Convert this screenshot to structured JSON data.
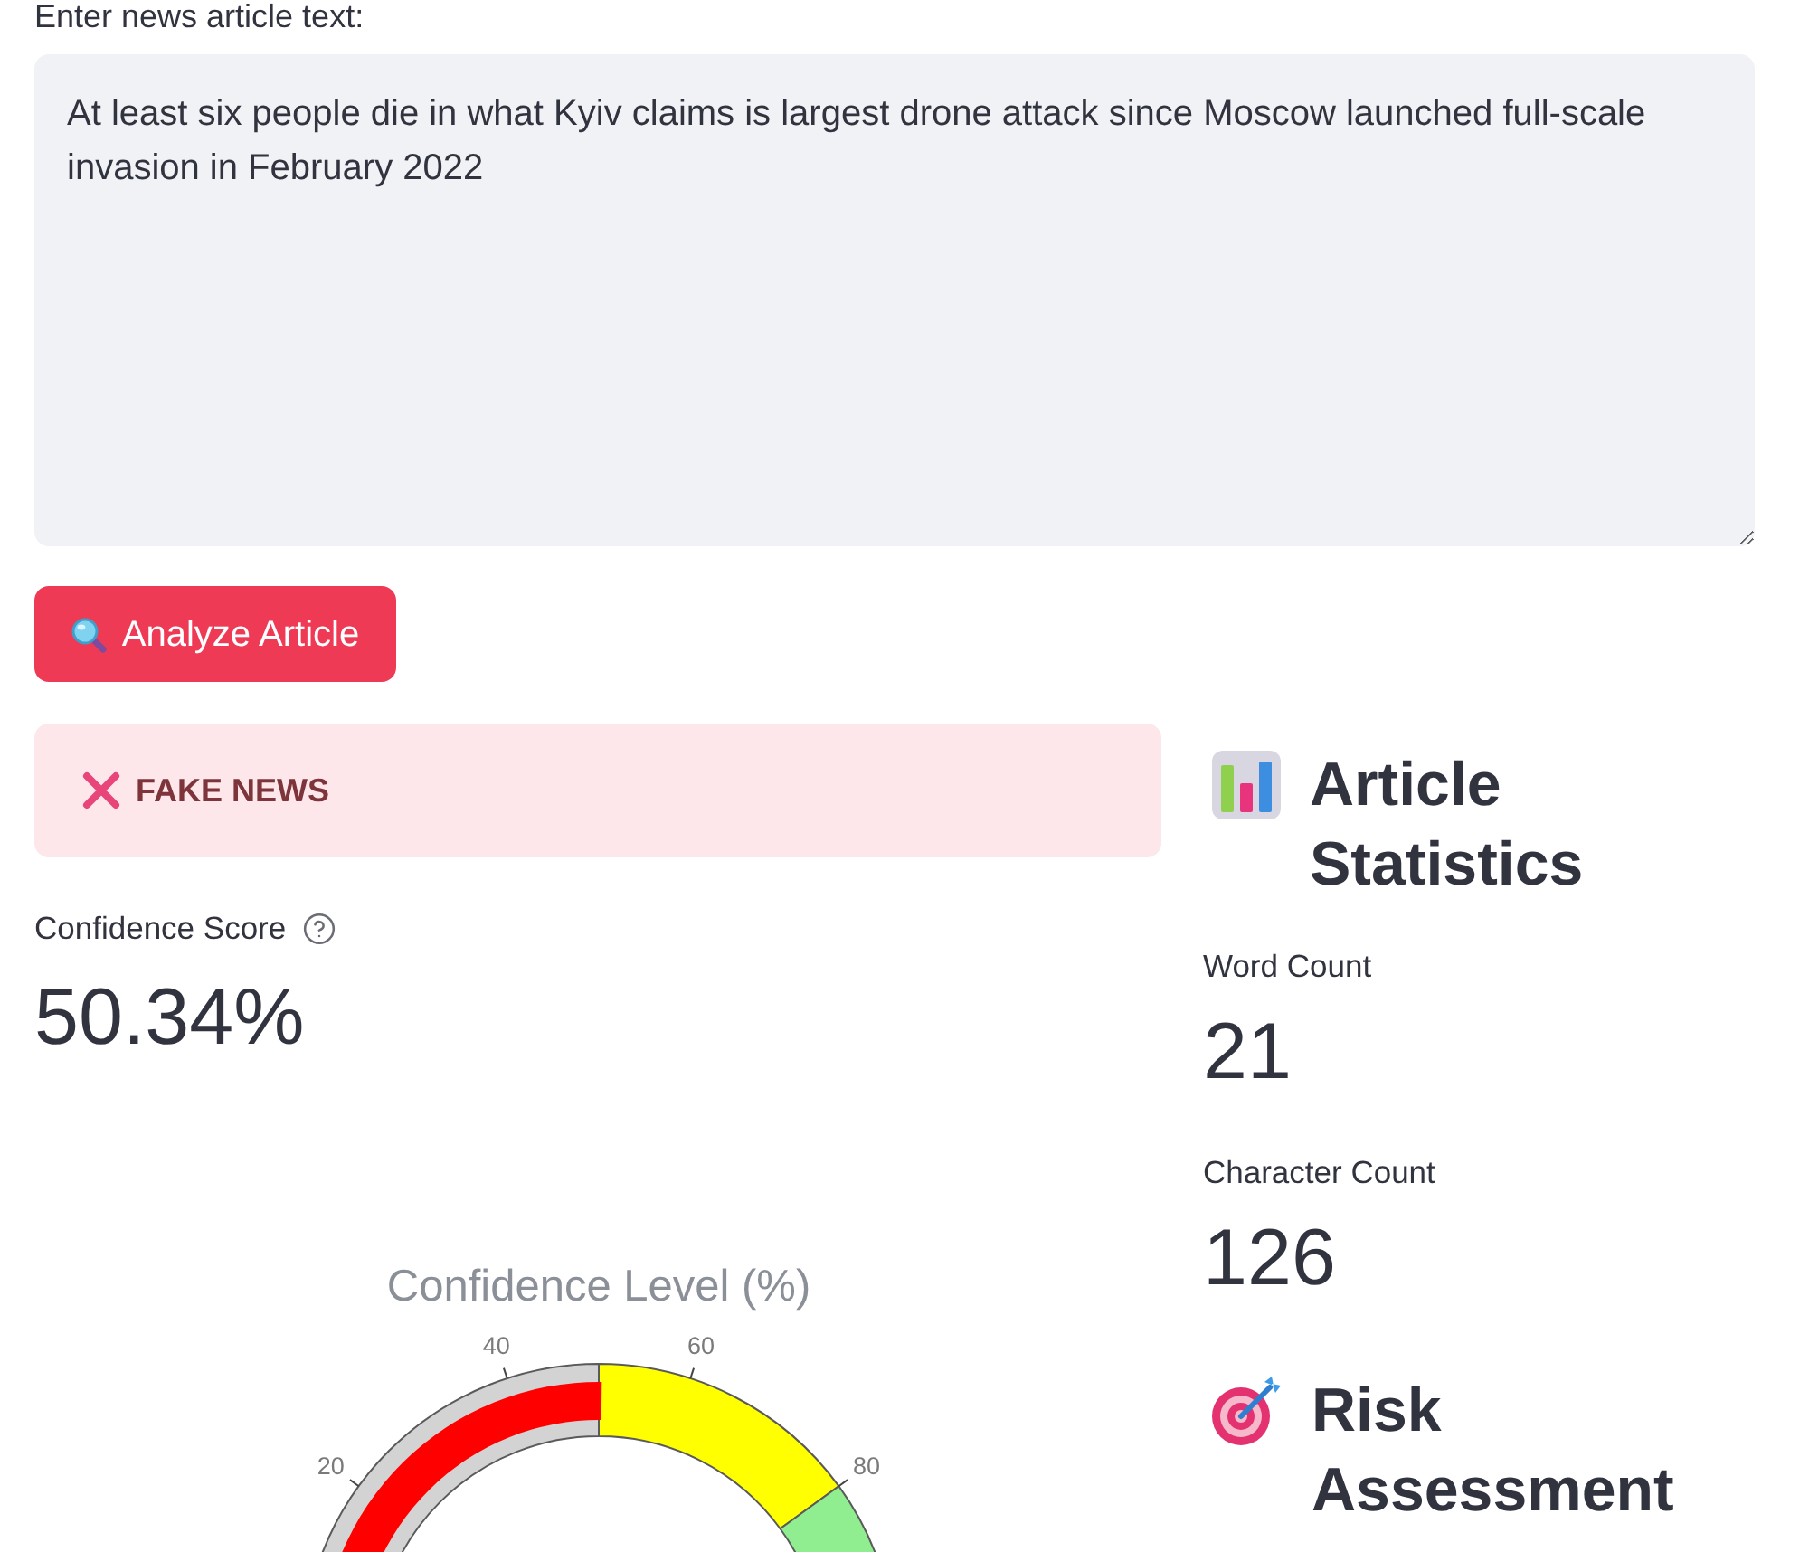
{
  "input": {
    "label": "Enter news article text:",
    "value": "At least six people die in what Kyiv claims is largest drone attack since Moscow launched full-scale invasion in February 2022"
  },
  "analyze_button": {
    "label": "Analyze Article"
  },
  "result": {
    "kind": "error",
    "label": "FAKE NEWS"
  },
  "confidence": {
    "label": "Confidence Score",
    "value": "50.34%"
  },
  "gauge": {
    "title": "Confidence Level (%)",
    "ticks": [
      "20",
      "40",
      "60",
      "80"
    ],
    "bands": [
      {
        "color": "#d3d3d3"
      },
      {
        "color": "#ffff00"
      },
      {
        "color": "#90ee90"
      }
    ]
  },
  "statistics": {
    "heading": "Article Statistics",
    "metrics": [
      {
        "label": "Word Count",
        "value": "21"
      },
      {
        "label": "Character Count",
        "value": "126"
      }
    ]
  },
  "risk": {
    "heading": "Risk Assessment"
  }
}
